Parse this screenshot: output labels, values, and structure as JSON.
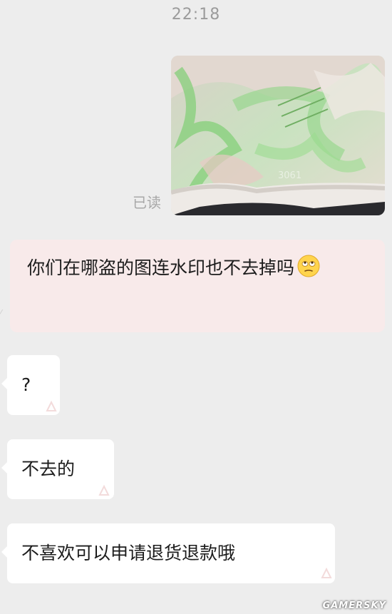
{
  "header": {
    "time": "22:18"
  },
  "messages": [
    {
      "side": "right",
      "type": "image",
      "status": "已读"
    },
    {
      "side": "right",
      "type": "text",
      "text": "你们在哪盗的图连水印也不去掉吗",
      "emoji": "rolling-eyes-emoji"
    },
    {
      "side": "left",
      "type": "text",
      "text": "?"
    },
    {
      "side": "left",
      "type": "text",
      "text": "不去的"
    },
    {
      "side": "left",
      "type": "text",
      "text": "不喜欢可以申请退货退款哦"
    }
  ],
  "watermark": "GAMERSKY",
  "colors": {
    "background": "#ededed",
    "bubble_me": "#f8eaea",
    "bubble_other": "#ffffff"
  }
}
